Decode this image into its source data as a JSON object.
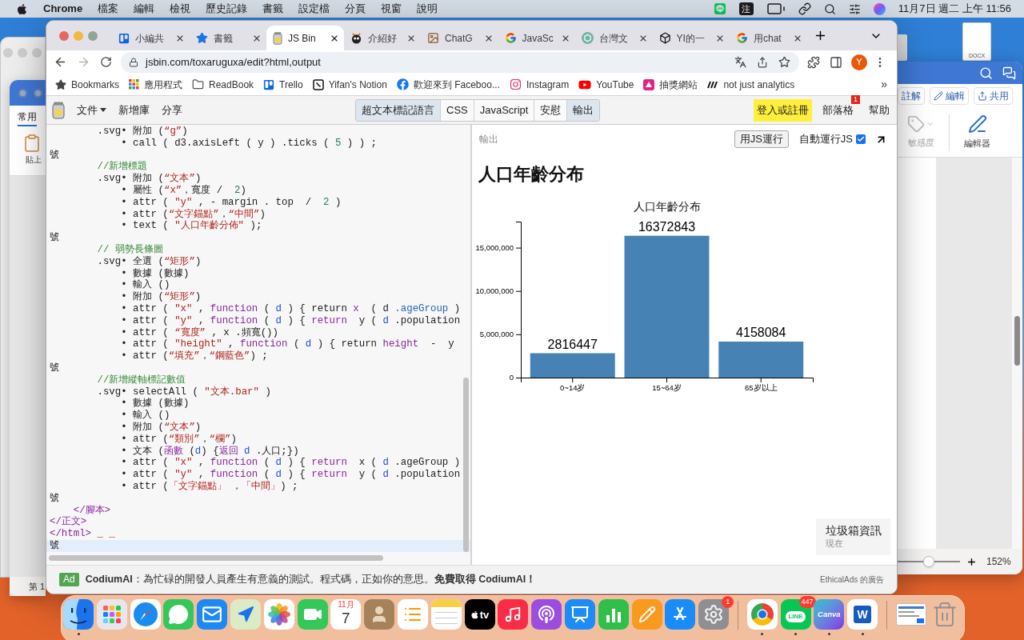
{
  "menu_bar": {
    "app": "Chrome",
    "menus": [
      "檔案",
      "編輯",
      "檢視",
      "歷史記錄",
      "書籤",
      "設定檔",
      "分頁",
      "視窗",
      "說明"
    ],
    "input_method": "注",
    "clock": "11月7日 週二 上午 11:56"
  },
  "desktop": {
    "file_label": "DOCX"
  },
  "left_window": {
    "tab": "常用",
    "paste": "貼上",
    "status": "第 1"
  },
  "right_window": {
    "buttons": [
      {
        "kind": "plain",
        "label": "註解"
      },
      {
        "kind": "pencil",
        "label": "編輯"
      },
      {
        "kind": "share",
        "label": "共用"
      }
    ],
    "tools": [
      {
        "kind": "tag",
        "label": "敏感度",
        "disabled": true
      },
      {
        "kind": "pen",
        "label": "編輯器",
        "disabled": false
      }
    ],
    "zoom": {
      "level": 0.5,
      "reading": "152%"
    }
  },
  "browser": {
    "tabs": [
      {
        "kind": "trello",
        "title": "小編共",
        "selected": false
      },
      {
        "kind": "star",
        "title": "書籤",
        "selected": false
      },
      {
        "kind": "jsbin",
        "title": "JS Bin",
        "selected": true
      },
      {
        "kind": "mascot",
        "title": "介紹好",
        "selected": false
      },
      {
        "kind": "image",
        "title": "ChatG",
        "selected": false
      },
      {
        "kind": "google",
        "title": "JavaSc",
        "selected": false
      },
      {
        "kind": "openai",
        "title": "台灣文",
        "selected": false
      },
      {
        "kind": "cube",
        "title": "YI的一",
        "selected": false
      },
      {
        "kind": "google",
        "title": "用chat",
        "selected": false
      }
    ],
    "url": "jsbin.com/toxaruguxa/edit?html,output",
    "profile": "Y",
    "bookmarks": [
      {
        "kind": "star",
        "label": "Bookmarks"
      },
      {
        "kind": "apps",
        "label": "應用程式"
      },
      {
        "kind": "folder",
        "label": "ReadBook"
      },
      {
        "kind": "trello",
        "label": "Trello"
      },
      {
        "kind": "notion",
        "label": "Yifan's Notion"
      },
      {
        "kind": "facebook",
        "label": "歡迎來到 Faceboo..."
      },
      {
        "kind": "instagram",
        "label": "Instagram"
      },
      {
        "kind": "youtube",
        "label": "YouTube"
      },
      {
        "kind": "prize",
        "label": "抽獎網站"
      },
      {
        "kind": "analytics",
        "label": "not just analytics"
      }
    ],
    "more": "»"
  },
  "jsbin": {
    "menu": [
      {
        "label": "文件",
        "dropdown": true
      },
      {
        "label": "新增庫",
        "dropdown": false
      },
      {
        "label": "分享",
        "dropdown": false
      }
    ],
    "panels": [
      {
        "label": "超文本標記語言",
        "selected": true
      },
      {
        "label": "CSS",
        "selected": false
      },
      {
        "label": "JavaScript",
        "selected": false
      },
      {
        "label": "安慰",
        "selected": false
      },
      {
        "label": "輸出",
        "selected": true
      }
    ],
    "login": "登入或註冊",
    "blog": {
      "label": "部落格",
      "badge": "1"
    },
    "help": "幫助"
  },
  "editor": {
    "lines": [
      {
        "tokens": [
          {
            "kind": "plain",
            "text": "        .svg• 附加 ("
          },
          {
            "kind": "string",
            "text": "“g”"
          },
          {
            "kind": "plain",
            "text": ")"
          }
        ],
        "current": false
      },
      {
        "tokens": [
          {
            "kind": "plain",
            "text": "            • call ( d3.axisLeft ( y ) .ticks ( "
          },
          {
            "kind": "number",
            "text": "5"
          },
          {
            "kind": "plain",
            "text": " ) ) ;"
          }
        ],
        "current": false
      },
      {
        "tokens": [
          {
            "kind": "plain",
            "text": "號"
          }
        ],
        "current": false
      },
      {
        "tokens": [
          {
            "kind": "comment",
            "text": "        //新增標題"
          }
        ],
        "current": false
      },
      {
        "tokens": [
          {
            "kind": "plain",
            "text": "        .svg• 附加 ("
          },
          {
            "kind": "string",
            "text": "“文本”"
          },
          {
            "kind": "plain",
            "text": ")"
          }
        ],
        "current": false
      },
      {
        "tokens": [
          {
            "kind": "plain",
            "text": "            • 屬性 ("
          },
          {
            "kind": "string",
            "text": "“x”"
          },
          {
            "kind": "plain",
            "text": "，寬度 /  "
          },
          {
            "kind": "number",
            "text": "2"
          },
          {
            "kind": "plain",
            "text": ")"
          }
        ],
        "current": false
      },
      {
        "tokens": [
          {
            "kind": "plain",
            "text": "            • attr ( "
          },
          {
            "kind": "string",
            "text": "\"y\""
          },
          {
            "kind": "plain",
            "text": " , - margin . top  /  "
          },
          {
            "kind": "number",
            "text": "2"
          },
          {
            "kind": "plain",
            "text": " )"
          }
        ],
        "current": false
      },
      {
        "tokens": [
          {
            "kind": "plain",
            "text": "            • attr ("
          },
          {
            "kind": "string",
            "text": "“文字錨點”"
          },
          {
            "kind": "plain",
            "text": "，"
          },
          {
            "kind": "string",
            "text": "“中間”"
          },
          {
            "kind": "plain",
            "text": ")"
          }
        ],
        "current": false
      },
      {
        "tokens": [
          {
            "kind": "plain",
            "text": "            • text ( "
          },
          {
            "kind": "string",
            "text": "\"人口年齡分佈\""
          },
          {
            "kind": "plain",
            "text": " );"
          }
        ],
        "current": false
      },
      {
        "tokens": [
          {
            "kind": "plain",
            "text": "號"
          }
        ],
        "current": false
      },
      {
        "tokens": [
          {
            "kind": "comment",
            "text": "        // 弱勢長條圖"
          }
        ],
        "current": false
      },
      {
        "tokens": [
          {
            "kind": "plain",
            "text": "        .svg• 全選 ("
          },
          {
            "kind": "string",
            "text": "“矩形”"
          },
          {
            "kind": "plain",
            "text": ")"
          }
        ],
        "current": false
      },
      {
        "tokens": [
          {
            "kind": "plain",
            "text": "            • 數據 (數據)"
          }
        ],
        "current": false
      },
      {
        "tokens": [
          {
            "kind": "plain",
            "text": "            • 輸入 ()"
          }
        ],
        "current": false
      },
      {
        "tokens": [
          {
            "kind": "plain",
            "text": "            • 附加 ("
          },
          {
            "kind": "string",
            "text": "“矩形”"
          },
          {
            "kind": "plain",
            "text": ")"
          }
        ],
        "current": false
      },
      {
        "tokens": [
          {
            "kind": "plain",
            "text": "            • attr ( "
          },
          {
            "kind": "string",
            "text": "\"x\""
          },
          {
            "kind": "plain",
            "text": " , "
          },
          {
            "kind": "keyword",
            "text": "function"
          },
          {
            "kind": "plain",
            "text": " ( "
          },
          {
            "kind": "variable",
            "text": "d"
          },
          {
            "kind": "plain",
            "text": " ) { return "
          },
          {
            "kind": "keyword",
            "text": "x"
          },
          {
            "kind": "plain",
            "text": "  ( d "
          },
          {
            "kind": "property",
            "text": ".ageGroup"
          },
          {
            "kind": "plain",
            "text": " )"
          }
        ],
        "current": false
      },
      {
        "tokens": [
          {
            "kind": "plain",
            "text": "            • attr ( "
          },
          {
            "kind": "string",
            "text": "\"y\""
          },
          {
            "kind": "plain",
            "text": " , "
          },
          {
            "kind": "keyword",
            "text": "function"
          },
          {
            "kind": "plain",
            "text": " ( "
          },
          {
            "kind": "variable",
            "text": "d"
          },
          {
            "kind": "plain",
            "text": " ) { "
          },
          {
            "kind": "keyword",
            "text": "return"
          },
          {
            "kind": "plain",
            "text": "  y ( "
          },
          {
            "kind": "variable",
            "text": "d"
          },
          {
            "kind": "plain",
            "text": " .population"
          }
        ],
        "current": false
      },
      {
        "tokens": [
          {
            "kind": "plain",
            "text": "            • attr ( "
          },
          {
            "kind": "string",
            "text": "“寬度”"
          },
          {
            "kind": "plain",
            "text": " , x .頻寬())"
          }
        ],
        "current": false
      },
      {
        "tokens": [
          {
            "kind": "plain",
            "text": "            • attr ( "
          },
          {
            "kind": "string",
            "text": "\"height\""
          },
          {
            "kind": "plain",
            "text": " , "
          },
          {
            "kind": "keyword",
            "text": "function"
          },
          {
            "kind": "plain",
            "text": " ( "
          },
          {
            "kind": "variable",
            "text": "d"
          },
          {
            "kind": "plain",
            "text": " ) { return "
          },
          {
            "kind": "keyword",
            "text": "height"
          },
          {
            "kind": "plain",
            "text": "  -  y"
          }
        ],
        "current": false
      },
      {
        "tokens": [
          {
            "kind": "plain",
            "text": "            • attr ("
          },
          {
            "kind": "string",
            "text": "“填充”"
          },
          {
            "kind": "plain",
            "text": "，"
          },
          {
            "kind": "string",
            "text": "“鋼藍色”"
          },
          {
            "kind": "plain",
            "text": ") ;"
          }
        ],
        "current": false
      },
      {
        "tokens": [
          {
            "kind": "plain",
            "text": "號"
          }
        ],
        "current": false
      },
      {
        "tokens": [
          {
            "kind": "comment",
            "text": "        //新增縱軸標記數值"
          }
        ],
        "current": false
      },
      {
        "tokens": [
          {
            "kind": "plain",
            "text": "        .svg• selectAll ( "
          },
          {
            "kind": "string",
            "text": "\"文本.bar\""
          },
          {
            "kind": "plain",
            "text": " )"
          }
        ],
        "current": false
      },
      {
        "tokens": [
          {
            "kind": "plain",
            "text": "            • 數據 (數據)"
          }
        ],
        "current": false
      },
      {
        "tokens": [
          {
            "kind": "plain",
            "text": "            • 輸入 ()"
          }
        ],
        "current": false
      },
      {
        "tokens": [
          {
            "kind": "plain",
            "text": "            • 附加 ("
          },
          {
            "kind": "string",
            "text": "“文本”"
          },
          {
            "kind": "plain",
            "text": ")"
          }
        ],
        "current": false
      },
      {
        "tokens": [
          {
            "kind": "plain",
            "text": "            • attr ("
          },
          {
            "kind": "string",
            "text": "“類別”"
          },
          {
            "kind": "plain",
            "text": "，"
          },
          {
            "kind": "string",
            "text": "“欄”"
          },
          {
            "kind": "plain",
            "text": ")"
          }
        ],
        "current": false
      },
      {
        "tokens": [
          {
            "kind": "plain",
            "text": "            • 文本 ("
          },
          {
            "kind": "keyword",
            "text": "函數"
          },
          {
            "kind": "plain",
            "text": " ("
          },
          {
            "kind": "variable",
            "text": "d"
          },
          {
            "kind": "plain",
            "text": ") {"
          },
          {
            "kind": "keyword",
            "text": "返回"
          },
          {
            "kind": "variable",
            "text": " d"
          },
          {
            "kind": "plain",
            "text": " .人口;})"
          }
        ],
        "current": false
      },
      {
        "tokens": [
          {
            "kind": "plain",
            "text": "            • attr ( "
          },
          {
            "kind": "string",
            "text": "\"x\""
          },
          {
            "kind": "plain",
            "text": " , "
          },
          {
            "kind": "keyword",
            "text": "function"
          },
          {
            "kind": "plain",
            "text": " ( "
          },
          {
            "kind": "variable",
            "text": "d"
          },
          {
            "kind": "plain",
            "text": " ) { "
          },
          {
            "kind": "keyword",
            "text": "return"
          },
          {
            "kind": "plain",
            "text": "  x ( "
          },
          {
            "kind": "variable",
            "text": "d"
          },
          {
            "kind": "plain",
            "text": " .ageGroup )"
          }
        ],
        "current": false
      },
      {
        "tokens": [
          {
            "kind": "plain",
            "text": "            • attr ( "
          },
          {
            "kind": "string",
            "text": "\"y\""
          },
          {
            "kind": "plain",
            "text": " , "
          },
          {
            "kind": "keyword",
            "text": "function"
          },
          {
            "kind": "plain",
            "text": " ( "
          },
          {
            "kind": "variable",
            "text": "d"
          },
          {
            "kind": "plain",
            "text": " ) { "
          },
          {
            "kind": "keyword",
            "text": "return"
          },
          {
            "kind": "plain",
            "text": "  y ( "
          },
          {
            "kind": "variable",
            "text": "d"
          },
          {
            "kind": "plain",
            "text": " .population"
          }
        ],
        "current": false
      },
      {
        "tokens": [
          {
            "kind": "plain",
            "text": "            • attr ("
          },
          {
            "kind": "string",
            "text": "「文字錨點」"
          },
          {
            "kind": "plain",
            "text": " ，"
          },
          {
            "kind": "string",
            "text": "「中間」"
          },
          {
            "kind": "plain",
            "text": ") ;"
          }
        ],
        "current": false
      },
      {
        "tokens": [
          {
            "kind": "plain",
            "text": "號"
          }
        ],
        "current": false
      },
      {
        "tokens": [
          {
            "kind": "tag",
            "text": "    </腳本>"
          }
        ],
        "current": false
      },
      {
        "tokens": [
          {
            "kind": "tag",
            "text": "</正文>"
          }
        ],
        "current": false
      },
      {
        "tokens": [
          {
            "kind": "tag",
            "text": "</html>"
          },
          {
            "kind": "error",
            "text": " _ _"
          }
        ],
        "current": false
      },
      {
        "tokens": [
          {
            "kind": "plain",
            "text": "號"
          }
        ],
        "current": true
      }
    ]
  },
  "output": {
    "label": "輸出",
    "run_button": "用JS運行",
    "auto_run": {
      "label": "自動運行JS",
      "checked": true
    },
    "heading": "人口年齡分布",
    "chart_data": {
      "type": "bar",
      "title": "人口年齡分布",
      "categories": [
        "0~14岁",
        "15~64岁",
        "65岁以上"
      ],
      "series": [
        {
          "color": "#4682b4",
          "values": [
            2816447,
            16372843,
            4158084
          ]
        }
      ],
      "ylim": [
        0,
        18010127
      ],
      "yticks": [
        {
          "value": 0,
          "label": "0"
        },
        {
          "value": 5000000,
          "label": "5,000,000"
        },
        {
          "value": 10000000,
          "label": "10,000,000"
        },
        {
          "value": 15000000,
          "label": "15,000,000"
        }
      ],
      "data_labels": true
    },
    "bin_info": {
      "title": "垃圾箱資訊",
      "time": "現在"
    }
  },
  "ad": {
    "badge": "Ad",
    "text": "**CodiumAI**：為忙碌的開發人員產生有意義的測試。程式碼，正如你的意思。**免費取得 CodiumAI！**",
    "credit": "EthicalAds 的廣告"
  },
  "dock": {
    "items": [
      {
        "kind": "finder",
        "running": true
      },
      {
        "kind": "launchpad",
        "running": false
      },
      {
        "kind": "safari",
        "running": false
      },
      {
        "kind": "messages",
        "running": false
      },
      {
        "kind": "mail",
        "running": false
      },
      {
        "kind": "maps",
        "running": false
      },
      {
        "kind": "photos",
        "running": false
      },
      {
        "kind": "facetime",
        "running": false
      },
      {
        "kind": "calendar",
        "month": "11月",
        "day": "7",
        "running": false
      },
      {
        "kind": "contacts",
        "running": false
      },
      {
        "kind": "reminders",
        "running": false
      },
      {
        "kind": "notes",
        "running": false
      },
      {
        "kind": "tv",
        "label": "tv",
        "running": false
      },
      {
        "kind": "music",
        "running": false
      },
      {
        "kind": "podcasts",
        "running": false
      },
      {
        "kind": "keynote",
        "running": false
      },
      {
        "kind": "numbers",
        "running": false
      },
      {
        "kind": "pages",
        "running": false
      },
      {
        "kind": "appstore",
        "running": false
      },
      {
        "kind": "settings",
        "badge": "1",
        "running": false
      },
      {
        "kind": "separator"
      },
      {
        "kind": "chrome",
        "running": true
      },
      {
        "kind": "line",
        "label": "LINE",
        "badge": "447",
        "running": true
      },
      {
        "kind": "canva",
        "label": "Canva",
        "running": true
      },
      {
        "kind": "word",
        "label": "W",
        "running": true
      },
      {
        "kind": "separator"
      },
      {
        "kind": "thumbnail",
        "running": false
      },
      {
        "kind": "trash",
        "running": false
      }
    ]
  }
}
